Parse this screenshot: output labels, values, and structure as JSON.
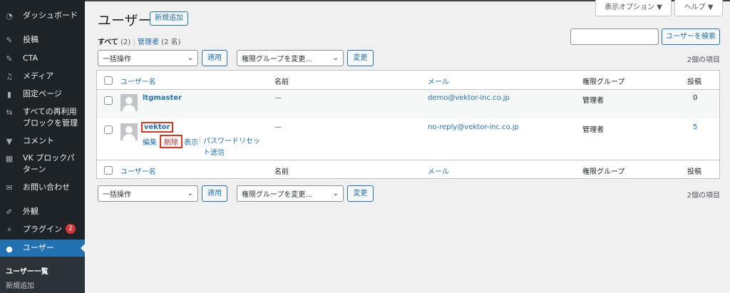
{
  "sidebar": {
    "items": [
      {
        "label": "ダッシュボード",
        "icon": "dashboard-icon"
      },
      {
        "label": "投稿",
        "icon": "pin-icon"
      },
      {
        "label": "CTA",
        "icon": "pin-icon"
      },
      {
        "label": "メディア",
        "icon": "media-icon"
      },
      {
        "label": "固定ページ",
        "icon": "pages-icon"
      },
      {
        "label": "すべての再利用ブロックを管理",
        "icon": "reusable-block-icon"
      },
      {
        "label": "コメント",
        "icon": "comment-icon"
      },
      {
        "label": "VK ブロックパターン",
        "icon": "grid-icon"
      },
      {
        "label": "お問い合わせ",
        "icon": "mail-icon"
      },
      {
        "label": "外観",
        "icon": "brush-icon"
      },
      {
        "label": "プラグイン",
        "icon": "plugin-icon",
        "badge": "2"
      },
      {
        "label": "ユーザー",
        "icon": "user-icon"
      }
    ],
    "submenu": [
      "ユーザー一覧",
      "新規追加"
    ]
  },
  "header": {
    "title": "ユーザー",
    "add_new": "新規追加",
    "screen_options": "表示オプション ▼",
    "help": "ヘルプ ▼"
  },
  "filters": {
    "all": "すべて",
    "all_count": "(2)",
    "admin": "管理者",
    "admin_count": "(2 名)"
  },
  "search": {
    "value": "",
    "button": "ユーザーを検索"
  },
  "bulk": {
    "action": "一括操作",
    "apply": "適用",
    "role": "権限グループを変更...",
    "change": "変更",
    "count": "2個の項目"
  },
  "table": {
    "headers": [
      "ユーザー名",
      "名前",
      "メール",
      "権限グループ",
      "投稿"
    ],
    "rows": [
      {
        "username": "ltgmaster",
        "name": "—",
        "email": "demo@vektor-inc.co.jp",
        "role": "管理者",
        "posts": "0"
      },
      {
        "username": "vektor",
        "name": "—",
        "email": "no-reply@vektor-inc.co.jp",
        "role": "管理者",
        "posts": "5",
        "actions": [
          "編集",
          "削除",
          "表示",
          "パスワードリセット送信"
        ]
      }
    ]
  },
  "colors": {
    "accent": "#2271b1",
    "highlight": "#e2341d"
  }
}
